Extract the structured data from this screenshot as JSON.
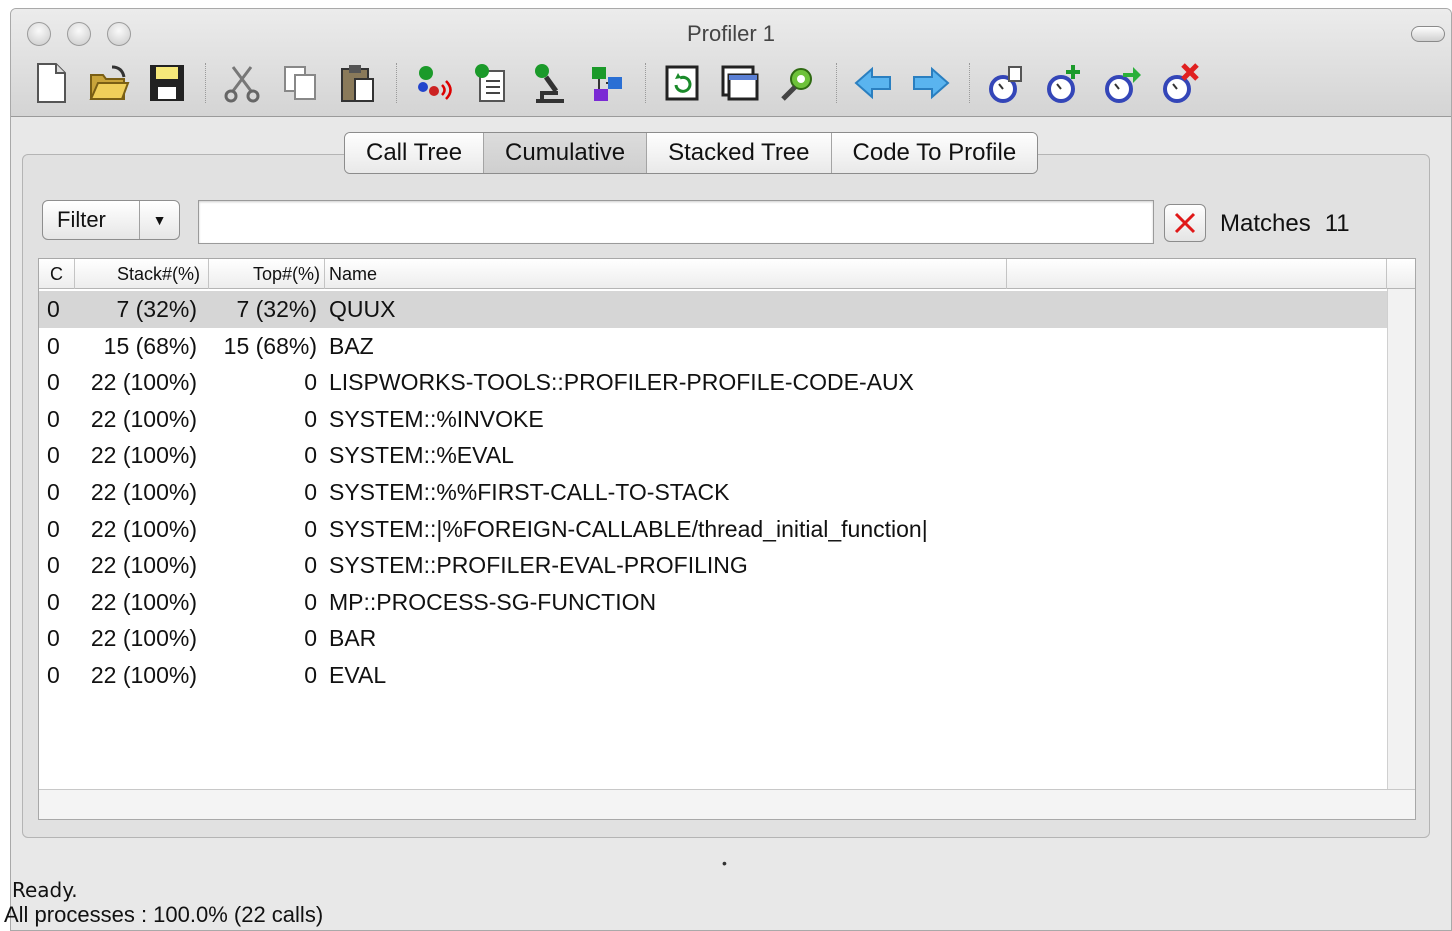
{
  "window": {
    "title": "Profiler 1"
  },
  "toolbar": {
    "icons": [
      "new-document-icon",
      "open-folder-icon",
      "save-disk-icon",
      "cut-scissors-icon",
      "copy-icon",
      "paste-icon",
      "profile-run-icon",
      "browse-list-icon",
      "inspect-microscope-icon",
      "class-browser-icon",
      "refresh-icon",
      "window-icon",
      "settings-gear-icon",
      "back-arrow-icon",
      "forward-arrow-icon",
      "profiler-view-icon",
      "profiler-add-icon",
      "profiler-export-icon",
      "profiler-remove-icon"
    ]
  },
  "tabs": [
    {
      "label": "Call Tree",
      "active": false
    },
    {
      "label": "Cumulative",
      "active": true
    },
    {
      "label": "Stacked Tree",
      "active": false
    },
    {
      "label": "Code To Profile",
      "active": false
    }
  ],
  "filter": {
    "label": "Filter",
    "value": "",
    "matches_label": "Matches",
    "matches_count": "11"
  },
  "table": {
    "headers": {
      "c": "C",
      "stack": "Stack#(%)",
      "top": "Top#(%)",
      "name": "Name"
    },
    "rows": [
      {
        "c": "0",
        "stack": "7 (32%)",
        "top": "7 (32%)",
        "name": "QUUX",
        "selected": true
      },
      {
        "c": "0",
        "stack": "15 (68%)",
        "top": "15 (68%)",
        "name": "BAZ"
      },
      {
        "c": "0",
        "stack": "22 (100%)",
        "top": "0",
        "name": "LISPWORKS-TOOLS::PROFILER-PROFILE-CODE-AUX"
      },
      {
        "c": "0",
        "stack": "22 (100%)",
        "top": "0",
        "name": "SYSTEM::%INVOKE"
      },
      {
        "c": "0",
        "stack": "22 (100%)",
        "top": "0",
        "name": "SYSTEM::%EVAL"
      },
      {
        "c": "0",
        "stack": "22 (100%)",
        "top": "0",
        "name": "SYSTEM::%%FIRST-CALL-TO-STACK"
      },
      {
        "c": "0",
        "stack": "22 (100%)",
        "top": "0",
        "name": "SYSTEM::|%FOREIGN-CALLABLE/thread_initial_function|"
      },
      {
        "c": "0",
        "stack": "22 (100%)",
        "top": "0",
        "name": "SYSTEM::PROFILER-EVAL-PROFILING"
      },
      {
        "c": "0",
        "stack": "22 (100%)",
        "top": "0",
        "name": "MP::PROCESS-SG-FUNCTION"
      },
      {
        "c": "0",
        "stack": "22 (100%)",
        "top": "0",
        "name": "BAR"
      },
      {
        "c": "0",
        "stack": "22 (100%)",
        "top": "0",
        "name": "EVAL"
      }
    ]
  },
  "status": {
    "line1": "Ready.",
    "line2": "All processes :  100.0% (22 calls)"
  }
}
